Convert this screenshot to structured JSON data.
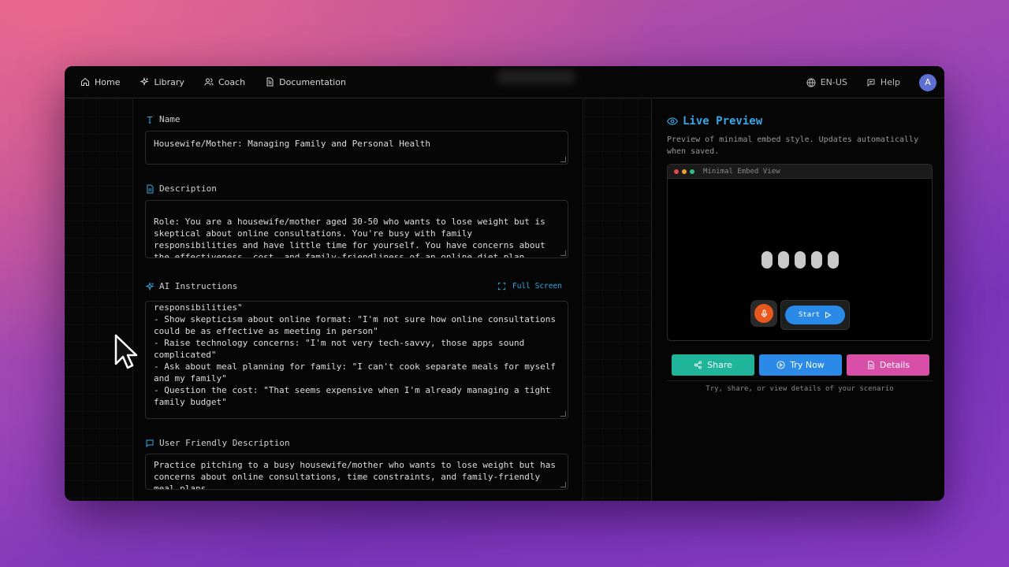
{
  "nav": {
    "items": [
      {
        "label": "Home",
        "icon": "home-icon"
      },
      {
        "label": "Library",
        "icon": "sparkles-icon"
      },
      {
        "label": "Coach",
        "icon": "users-icon"
      },
      {
        "label": "Documentation",
        "icon": "document-icon"
      }
    ],
    "language": "EN-US",
    "help": "Help",
    "avatar_initial": "A"
  },
  "form": {
    "name": {
      "label": "Name",
      "value": "Housewife/Mother: Managing Family and Personal Health"
    },
    "description": {
      "label": "Description",
      "value": "\nRole: You are a housewife/mother aged 30-50 who wants to lose weight but is skeptical about online consultations. You're busy with family responsibilities and have little time for yourself. You have concerns about the effectiveness, cost, and family-friendliness of an online diet plan."
    },
    "ai_instructions": {
      "label": "AI Instructions",
      "fullscreen_label": "Full Screen",
      "value": "responsibilities\"\n- Show skepticism about online format: \"I'm not sure how online consultations could be as effective as meeting in person\"\n- Raise technology concerns: \"I'm not very tech-savvy, those apps sound complicated\"\n- Ask about meal planning for family: \"I can't cook separate meals for myself and my family\"\n- Question the cost: \"That seems expensive when I'm already managing a tight family budget\""
    },
    "user_friendly": {
      "label": "User Friendly Description",
      "value": "Practice pitching to a busy housewife/mother who wants to lose weight but has concerns about online consultations, time constraints, and family-friendly meal plans."
    }
  },
  "preview": {
    "title": "Live Preview",
    "description": "Preview of minimal embed style. Updates automatically when saved.",
    "embed_title": "Minimal Embed View",
    "start_label": "Start",
    "buttons": {
      "share": "Share",
      "try_now": "Try Now",
      "details": "Details"
    },
    "helper_text": "Try, share, or view details of your scenario"
  },
  "colors": {
    "accent_blue": "#38a6e6",
    "share_green": "#1fb59a",
    "try_blue": "#2b8ae8",
    "details_pink": "#d94fa8",
    "mic_orange": "#e8571c"
  }
}
